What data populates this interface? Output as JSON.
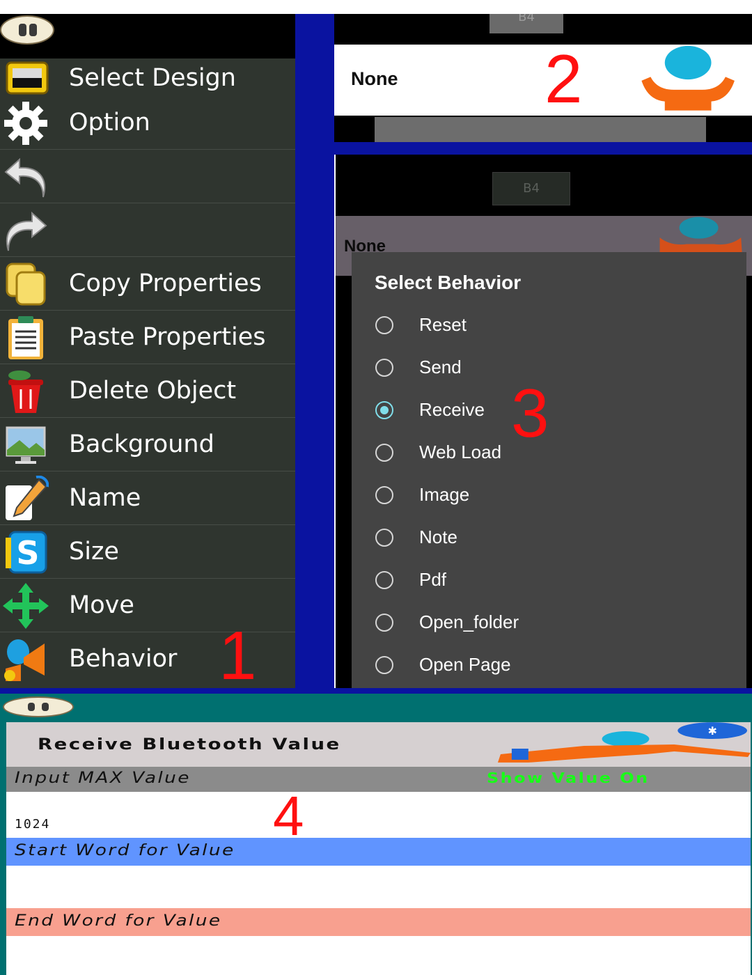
{
  "menu": {
    "items": [
      {
        "label": "Select Design",
        "icon": "design-frame-icon"
      },
      {
        "label": "Option",
        "icon": "gear-icon"
      },
      {
        "label": "",
        "icon": "undo-icon"
      },
      {
        "label": "",
        "icon": "redo-icon"
      },
      {
        "label": "Copy Properties",
        "icon": "copy-icon"
      },
      {
        "label": "Paste Properties",
        "icon": "clipboard-icon"
      },
      {
        "label": "Delete Object",
        "icon": "trash-icon"
      },
      {
        "label": "Background",
        "icon": "background-image-icon"
      },
      {
        "label": "Name",
        "icon": "pencil-icon"
      },
      {
        "label": "Size",
        "icon": "size-icon"
      },
      {
        "label": "Move",
        "icon": "move-arrows-icon"
      },
      {
        "label": "Behavior",
        "icon": "behavior-icon"
      }
    ]
  },
  "panel2": {
    "tab_label": "B4",
    "value": "None"
  },
  "panel3": {
    "tab_label": "B4",
    "value": "None",
    "dialog": {
      "title": "Select Behavior",
      "options": [
        "Reset",
        "Send",
        "Receive",
        "Web Load",
        "Image",
        "Note",
        "Pdf",
        "Open_folder",
        "Open Page"
      ],
      "selected": "Receive"
    }
  },
  "annotations": [
    "1",
    "2",
    "3",
    "4"
  ],
  "panel4": {
    "title": "Receive Bluetooth Value",
    "max_label": "Input MAX Value",
    "show_label": "Show Value On",
    "max_value": "1024",
    "start_label": "Start Word for Value",
    "start_value": "",
    "end_label": "End Word for Value",
    "end_value": ""
  },
  "colors": {
    "accent_blue": "#0a13a0",
    "menu_bg": "#2f352f",
    "teal": "#007070",
    "radio_selected": "#80deea",
    "annotation": "#ff1010",
    "show_value_green": "#18ff18",
    "start_row": "#6094ff",
    "end_row": "#f8a08f"
  }
}
